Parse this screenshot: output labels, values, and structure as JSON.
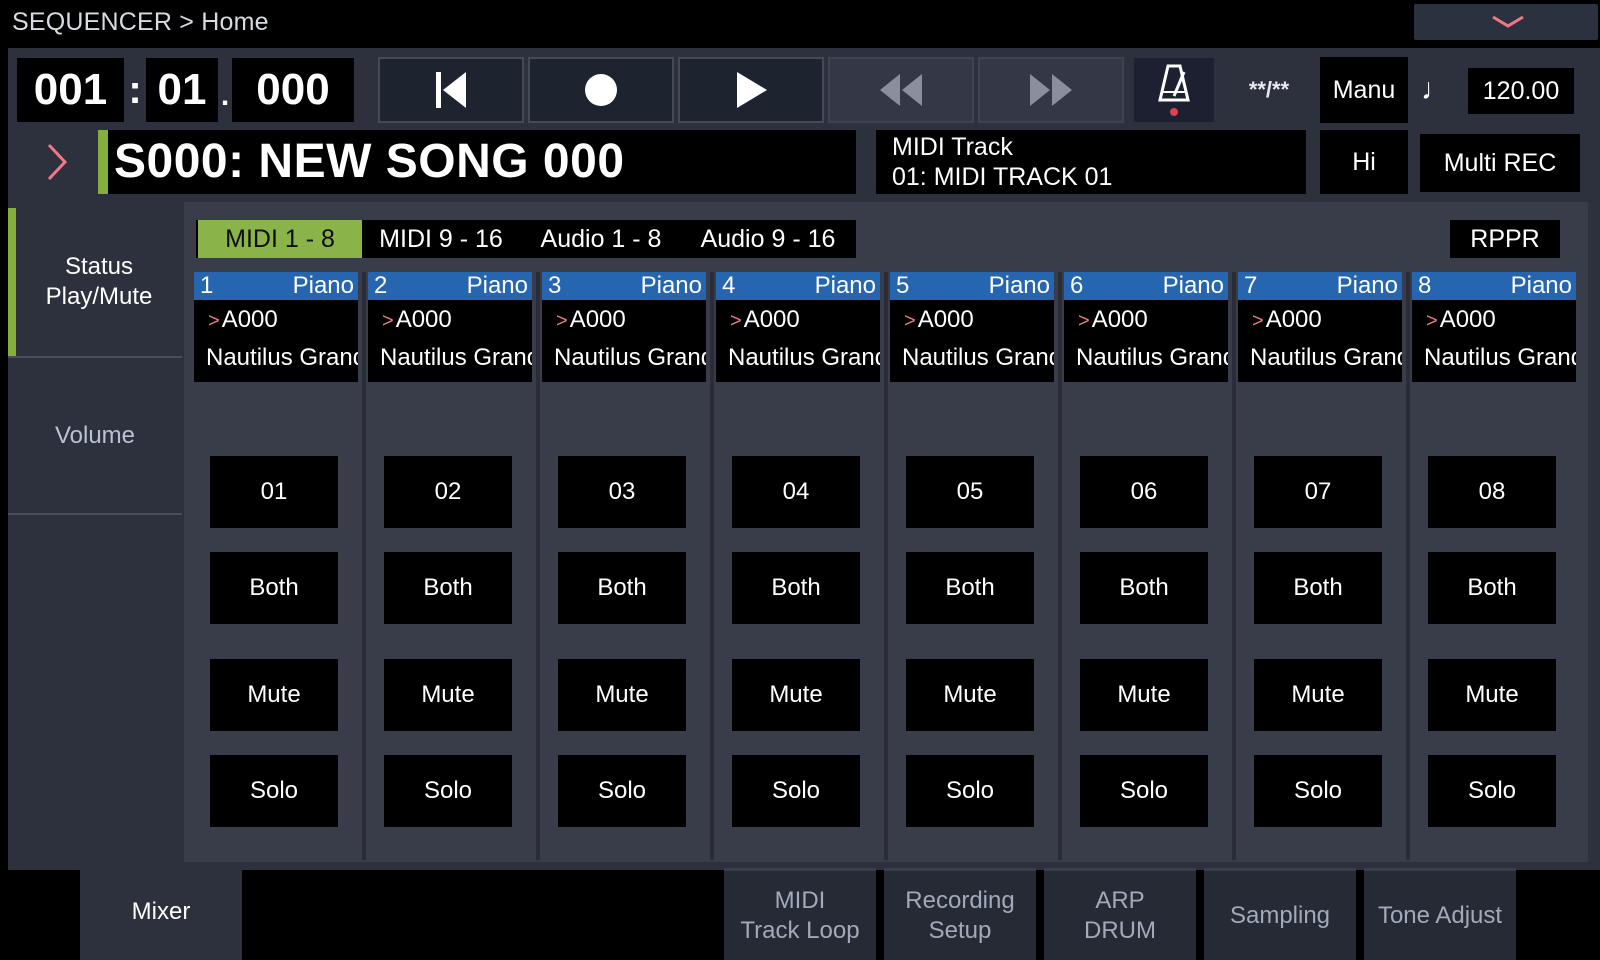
{
  "breadcrumb": "SEQUENCER > Home",
  "locator": {
    "bar": "001",
    "colon": ":",
    "beat": "01",
    "dot": ".",
    "tick": "000"
  },
  "transport": {
    "locate_icon": "skip-to-start-icon",
    "record_icon": "record-icon",
    "play_icon": "play-icon",
    "rewind_icon": "rewind-icon",
    "fast_forward_icon": "fast-forward-icon"
  },
  "metronome_icon": "metronome-icon",
  "time_signature": "**/**",
  "manual": "Manu",
  "note_icon": "♩",
  "tempo": "120.00",
  "song": {
    "name": "S000: NEW SONG 000"
  },
  "track": {
    "label": "MIDI Track",
    "name": "01: MIDI TRACK 01"
  },
  "hi": "Hi",
  "multi_rec": "Multi REC",
  "nav": {
    "status_line1": "Status",
    "status_line2": "Play/Mute",
    "volume": "Volume"
  },
  "bank_tabs": [
    "MIDI 1  - 8",
    "MIDI 9  - 16",
    "Audio 1  - 8",
    "Audio 9  - 16"
  ],
  "active_bank": 0,
  "rppr": "RPPR",
  "channels": [
    {
      "num": "1",
      "category": "Piano",
      "program": "A000",
      "program_name": "Nautilus Grand",
      "channel": "01",
      "status": "Both",
      "mute": "Mute",
      "solo": "Solo"
    },
    {
      "num": "2",
      "category": "Piano",
      "program": "A000",
      "program_name": "Nautilus Grand",
      "channel": "02",
      "status": "Both",
      "mute": "Mute",
      "solo": "Solo"
    },
    {
      "num": "3",
      "category": "Piano",
      "program": "A000",
      "program_name": "Nautilus Grand",
      "channel": "03",
      "status": "Both",
      "mute": "Mute",
      "solo": "Solo"
    },
    {
      "num": "4",
      "category": "Piano",
      "program": "A000",
      "program_name": "Nautilus Grand",
      "channel": "04",
      "status": "Both",
      "mute": "Mute",
      "solo": "Solo"
    },
    {
      "num": "5",
      "category": "Piano",
      "program": "A000",
      "program_name": "Nautilus Grand",
      "channel": "05",
      "status": "Both",
      "mute": "Mute",
      "solo": "Solo"
    },
    {
      "num": "6",
      "category": "Piano",
      "program": "A000",
      "program_name": "Nautilus Grand",
      "channel": "06",
      "status": "Both",
      "mute": "Mute",
      "solo": "Solo"
    },
    {
      "num": "7",
      "category": "Piano",
      "program": "A000",
      "program_name": "Nautilus Grand",
      "channel": "07",
      "status": "Both",
      "mute": "Mute",
      "solo": "Solo"
    },
    {
      "num": "8",
      "category": "Piano",
      "program": "A000",
      "program_name": "Nautilus Grand",
      "channel": "08",
      "status": "Both",
      "mute": "Mute",
      "solo": "Solo"
    }
  ],
  "bottom_tabs": {
    "mixer": "Mixer",
    "midi_track_loop": [
      "MIDI",
      "Track Loop"
    ],
    "recording_setup": [
      "Recording",
      "Setup"
    ],
    "arp_drum": [
      "ARP",
      "DRUM"
    ],
    "sampling": "Sampling",
    "tone_adjust": "Tone Adjust"
  },
  "colors": {
    "accent_green": "#8ab449",
    "channel_blue": "#2665b0",
    "panel": "#2d303d",
    "caret_pink": "#f07a84"
  }
}
